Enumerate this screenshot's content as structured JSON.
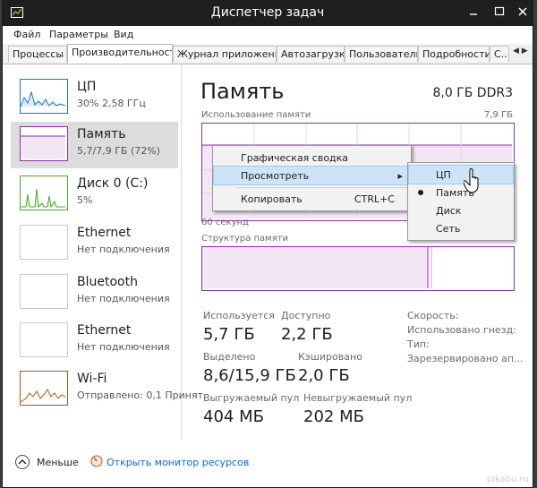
{
  "window": {
    "title": "Диспетчер задач"
  },
  "menu": [
    "Файл",
    "Параметры",
    "Вид"
  ],
  "tabs": [
    "Процессы",
    "Производительность",
    "Журнал приложений",
    "Автозагрузка",
    "Пользователи",
    "Подробности",
    "С..."
  ],
  "tab_arrows": "◀ ▶",
  "sidebar": [
    {
      "title": "ЦП",
      "sub": "30% 2,58 ГГц",
      "color": "#1a78c2"
    },
    {
      "title": "Память",
      "sub": "5,7/7,9 ГБ (72%)",
      "color": "#8b2fa5"
    },
    {
      "title": "Диск 0 (C:)",
      "sub": "5%",
      "color": "#4ea72e"
    },
    {
      "title": "Ethernet",
      "sub": "Нет подключения",
      "color": "#c9c9c9"
    },
    {
      "title": "Bluetooth",
      "sub": "Нет подключения",
      "color": "#c9c9c9"
    },
    {
      "title": "Ethernet",
      "sub": "Нет подключения",
      "color": "#c9c9c9"
    },
    {
      "title": "Wi-Fi",
      "sub": "Отправлено: 0,1 Принят",
      "color": "#a45a14"
    }
  ],
  "main": {
    "title": "Память",
    "capacity": "8,0 ГБ DDR3",
    "usage_label": "Использование памяти",
    "usage_max": "7,9 ГБ",
    "time_label": "60 секунд",
    "structure_label": "Структура памяти",
    "stats": [
      {
        "label": "Используется",
        "value": "5,7 ГБ"
      },
      {
        "label": "Доступно",
        "value": "2,2 ГБ"
      },
      {
        "label": "Выделено",
        "value": "8,6/15,9 ГБ"
      },
      {
        "label": "Кэшировано",
        "value": "2,0 ГБ"
      },
      {
        "label": "Выгружаемый пул",
        "value": "404 МБ"
      },
      {
        "label": "Невыгружаемый пул",
        "value": "202 МБ"
      }
    ],
    "right": [
      "Скорость:",
      "Использовано гнезд:",
      "Тип:",
      "Зарезервировано ап..."
    ]
  },
  "context_menu": {
    "items": [
      "Графическая сводка",
      "Просмотреть",
      "Копировать"
    ],
    "copy_shortcut": "CTRL+C",
    "arrow": "▸"
  },
  "submenu": [
    "ЦП",
    "Память",
    "Диск",
    "Сеть"
  ],
  "footer": {
    "less": "Меньше",
    "monitor": "Открыть монитор ресурсов"
  },
  "watermark": "pikabu.ru"
}
